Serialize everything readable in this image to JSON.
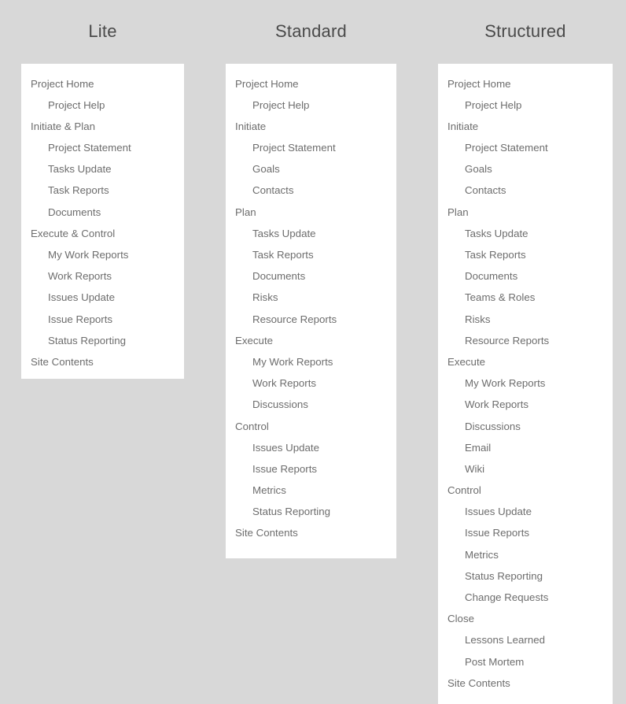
{
  "page": {
    "background_color": "#d8d8d8",
    "panel_color": "#ffffff",
    "text_color": "#6d6d6d",
    "title_color": "#4a4a4a"
  },
  "columns": [
    {
      "id": "lite",
      "title": "Lite",
      "items": [
        {
          "label": "Project Home",
          "level": 0
        },
        {
          "label": "Project Help",
          "level": 1
        },
        {
          "label": "Initiate & Plan",
          "level": 0
        },
        {
          "label": "Project Statement",
          "level": 1
        },
        {
          "label": "Tasks Update",
          "level": 1
        },
        {
          "label": "Task Reports",
          "level": 1
        },
        {
          "label": "Documents",
          "level": 1
        },
        {
          "label": "Execute & Control",
          "level": 0
        },
        {
          "label": "My Work Reports",
          "level": 1
        },
        {
          "label": "Work Reports",
          "level": 1
        },
        {
          "label": "Issues Update",
          "level": 1
        },
        {
          "label": "Issue Reports",
          "level": 1
        },
        {
          "label": "Status Reporting",
          "level": 1
        },
        {
          "label": "Site Contents",
          "level": 0
        }
      ]
    },
    {
      "id": "standard",
      "title": "Standard",
      "items": [
        {
          "label": "Project Home",
          "level": 0
        },
        {
          "label": "Project Help",
          "level": 1
        },
        {
          "label": "Initiate",
          "level": 0
        },
        {
          "label": "Project Statement",
          "level": 1
        },
        {
          "label": "Goals",
          "level": 1
        },
        {
          "label": "Contacts",
          "level": 1
        },
        {
          "label": "Plan",
          "level": 0
        },
        {
          "label": "Tasks Update",
          "level": 1
        },
        {
          "label": "Task Reports",
          "level": 1
        },
        {
          "label": "Documents",
          "level": 1
        },
        {
          "label": "Risks",
          "level": 1
        },
        {
          "label": "Resource Reports",
          "level": 1
        },
        {
          "label": "Execute",
          "level": 0
        },
        {
          "label": "My Work Reports",
          "level": 1
        },
        {
          "label": "Work Reports",
          "level": 1
        },
        {
          "label": "Discussions",
          "level": 1
        },
        {
          "label": "Control",
          "level": 0
        },
        {
          "label": "Issues Update",
          "level": 1
        },
        {
          "label": "Issue Reports",
          "level": 1
        },
        {
          "label": "Metrics",
          "level": 1
        },
        {
          "label": "Status Reporting",
          "level": 1
        },
        {
          "label": "Site Contents",
          "level": 0
        }
      ]
    },
    {
      "id": "structured",
      "title": "Structured",
      "items": [
        {
          "label": "Project Home",
          "level": 0
        },
        {
          "label": "Project Help",
          "level": 1
        },
        {
          "label": "Initiate",
          "level": 0
        },
        {
          "label": "Project Statement",
          "level": 1
        },
        {
          "label": "Goals",
          "level": 1
        },
        {
          "label": "Contacts",
          "level": 1
        },
        {
          "label": "Plan",
          "level": 0
        },
        {
          "label": "Tasks Update",
          "level": 1
        },
        {
          "label": "Task Reports",
          "level": 1
        },
        {
          "label": "Documents",
          "level": 1
        },
        {
          "label": "Teams & Roles",
          "level": 1
        },
        {
          "label": "Risks",
          "level": 1
        },
        {
          "label": "Resource Reports",
          "level": 1
        },
        {
          "label": "Execute",
          "level": 0
        },
        {
          "label": "My Work Reports",
          "level": 1
        },
        {
          "label": "Work Reports",
          "level": 1
        },
        {
          "label": "Discussions",
          "level": 1
        },
        {
          "label": "Email",
          "level": 1
        },
        {
          "label": "Wiki",
          "level": 1
        },
        {
          "label": "Control",
          "level": 0
        },
        {
          "label": "Issues Update",
          "level": 1
        },
        {
          "label": "Issue Reports",
          "level": 1
        },
        {
          "label": "Metrics",
          "level": 1
        },
        {
          "label": "Status Reporting",
          "level": 1
        },
        {
          "label": "Change Requests",
          "level": 1
        },
        {
          "label": "Close",
          "level": 0
        },
        {
          "label": "Lessons Learned",
          "level": 1
        },
        {
          "label": "Post Mortem",
          "level": 1
        },
        {
          "label": "Site Contents",
          "level": 0
        }
      ]
    }
  ]
}
